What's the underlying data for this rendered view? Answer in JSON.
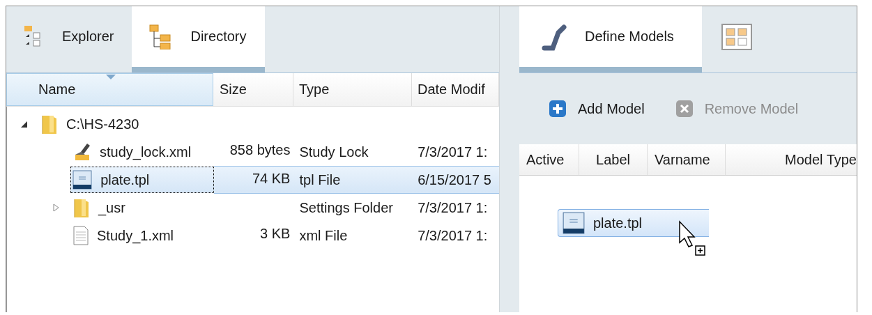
{
  "left_panel": {
    "tabs": [
      {
        "label": "Explorer",
        "kind": "explorer",
        "selected": false
      },
      {
        "label": "Directory",
        "kind": "directory",
        "selected": true
      }
    ],
    "columns": [
      {
        "label": "Name",
        "sorted": true
      },
      {
        "label": "Size",
        "sorted": false
      },
      {
        "label": "Type",
        "sorted": false
      },
      {
        "label": "Date Modif",
        "sorted": false
      }
    ],
    "rows": [
      {
        "name": "C:\\HS-4230",
        "kind": "folder",
        "expanded": true,
        "selected": false,
        "children": [
          {
            "name": "study_lock.xml",
            "kind": "lock",
            "size": "858 bytes",
            "type": "Study Lock",
            "date": "7/3/2017 1:",
            "selected": false
          },
          {
            "name": "plate.tpl",
            "kind": "template",
            "size": "74 KB",
            "type": "tpl File",
            "date": "6/15/2017 5",
            "selected": true
          },
          {
            "name": "_usr",
            "kind": "folder",
            "expanded": false,
            "type": "Settings Folder",
            "date": "7/3/2017 1:",
            "selected": false
          },
          {
            "name": "Study_1.xml",
            "kind": "file",
            "size": "3 KB",
            "type": "xml File",
            "date": "7/3/2017 1:",
            "selected": false
          }
        ]
      }
    ]
  },
  "right_panel": {
    "tabs": [
      {
        "label": "Define Models",
        "kind": "models",
        "selected": true
      },
      {
        "kind": "grid",
        "selected": false
      }
    ],
    "toolbar": [
      {
        "label": "Add Model",
        "kind": "add",
        "disabled": false
      },
      {
        "label": "Remove Model",
        "kind": "remove",
        "disabled": true
      }
    ],
    "columns": [
      "Active",
      "Label",
      "Varname",
      "Model Type"
    ],
    "drag_item": {
      "label": "plate.tpl",
      "kind": "template"
    }
  }
}
